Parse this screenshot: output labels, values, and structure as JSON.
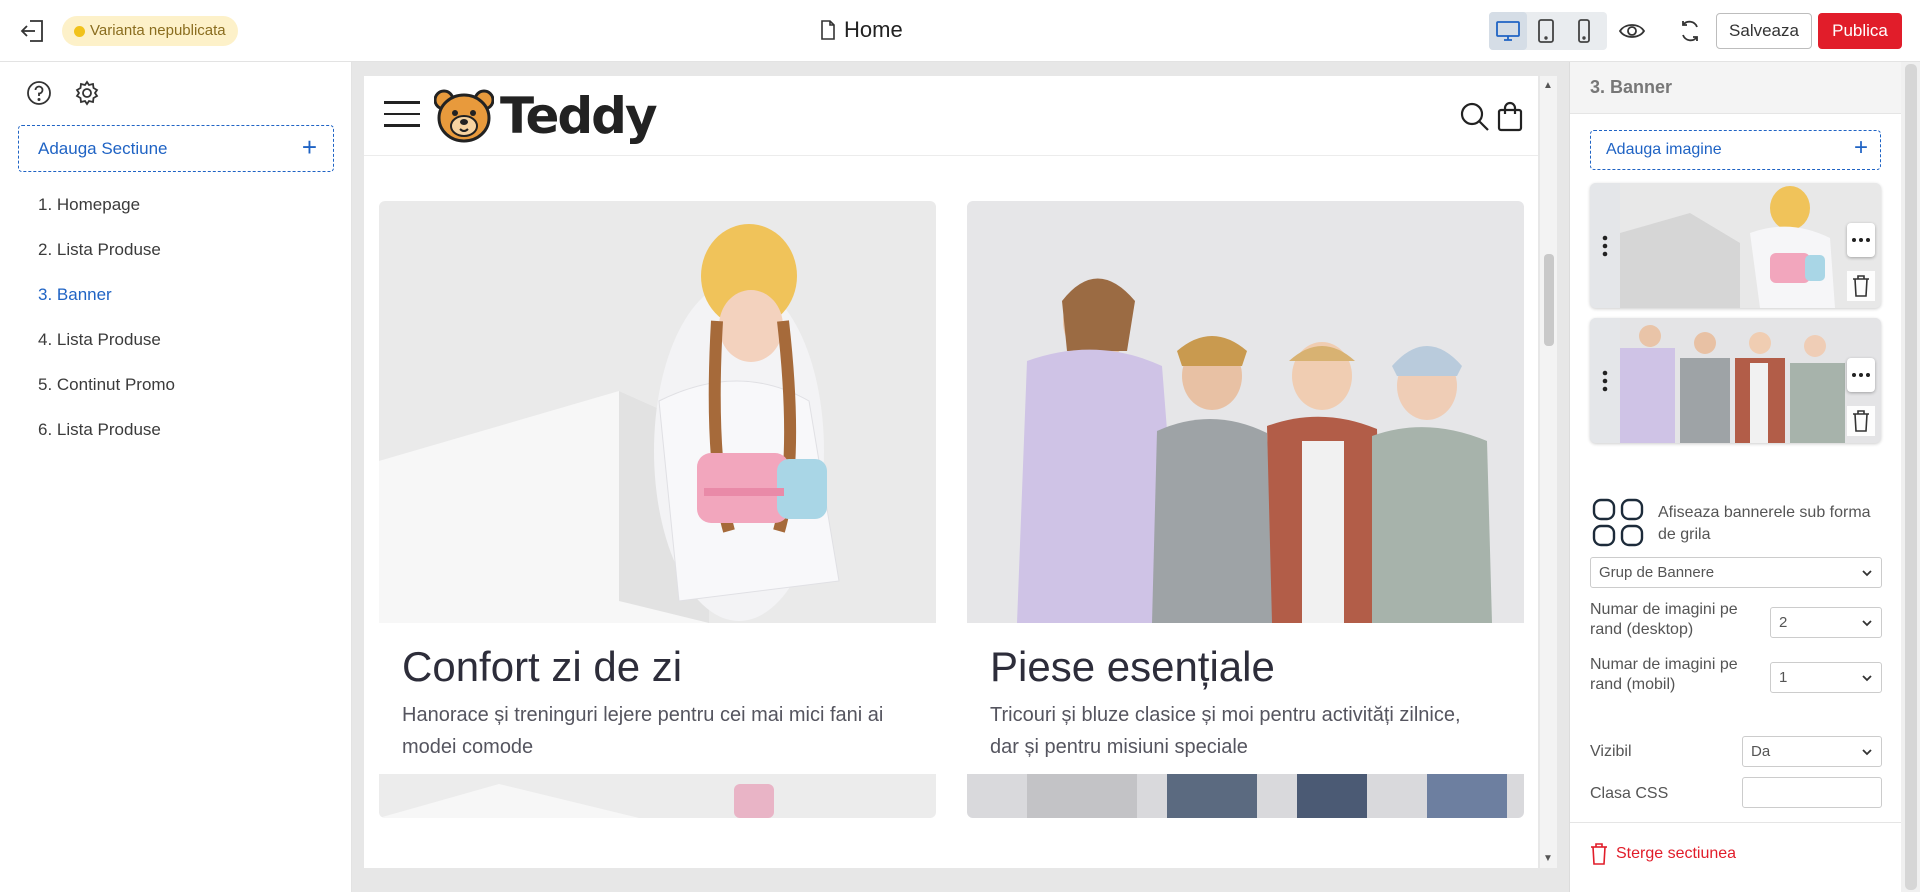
{
  "topbar": {
    "status_label": "Varianta nepublicata",
    "page_title": "Home",
    "save_label": "Salveaza",
    "publish_label": "Publica",
    "devices": [
      "desktop-icon",
      "tablet-icon",
      "mobile-icon"
    ],
    "active_device": "desktop",
    "colors": {
      "accent": "#1f63c4",
      "publish": "#e11d2a",
      "status_bg": "#fdf1c9"
    }
  },
  "sidebar": {
    "add_section_label": "Adauga Sectiune",
    "sections": [
      {
        "label": "1. Homepage",
        "active": false
      },
      {
        "label": "2. Lista Produse",
        "active": false
      },
      {
        "label": "3. Banner",
        "active": true
      },
      {
        "label": "4. Lista Produse",
        "active": false
      },
      {
        "label": "5. Continut Promo",
        "active": false
      },
      {
        "label": "6. Lista Produse",
        "active": false
      }
    ]
  },
  "preview": {
    "logo_text": "Teddy",
    "banners": [
      {
        "title": "Confort zi de zi",
        "description": "Hanorace și treninguri lejere pentru cei mai mici fani ai modei comode"
      },
      {
        "title": "Piese esențiale",
        "description": "Tricouri și bluze clasice și moi pentru activități zilnice, dar și pentru misiuni speciale"
      }
    ]
  },
  "panel": {
    "title": "3. Banner",
    "add_image_label": "Adauga imagine",
    "grid_toggle_label": "Afiseaza bannerele sub forma de grila",
    "group_select_value": "Grup de Bannere",
    "desktop_count_label": "Numar de imagini pe rand (desktop)",
    "desktop_count_value": "2",
    "mobile_count_label": "Numar de imagini pe rand (mobil)",
    "mobile_count_value": "1",
    "visible_label": "Vizibil",
    "visible_value": "Da",
    "css_class_label": "Clasa CSS",
    "css_class_value": "",
    "delete_label": "Sterge sectiunea"
  }
}
